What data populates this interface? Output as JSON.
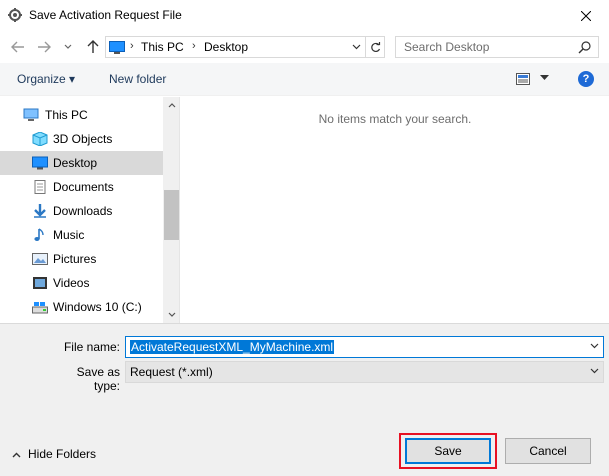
{
  "window": {
    "title": "Save Activation Request File"
  },
  "address": {
    "segments": [
      "This PC",
      "Desktop"
    ]
  },
  "search": {
    "placeholder": "Search Desktop"
  },
  "toolbar": {
    "organize_label": "Organize ▾",
    "new_folder_label": "New folder",
    "help_label": "?"
  },
  "navpane": {
    "items": [
      {
        "label": "This PC",
        "icon": "computer-icon",
        "indent": 0
      },
      {
        "label": "3D Objects",
        "icon": "3d-objects-icon",
        "indent": 1
      },
      {
        "label": "Desktop",
        "icon": "desktop-icon",
        "indent": 1,
        "selected": true
      },
      {
        "label": "Documents",
        "icon": "documents-icon",
        "indent": 1
      },
      {
        "label": "Downloads",
        "icon": "downloads-icon",
        "indent": 1
      },
      {
        "label": "Music",
        "icon": "music-icon",
        "indent": 1
      },
      {
        "label": "Pictures",
        "icon": "pictures-icon",
        "indent": 1
      },
      {
        "label": "Videos",
        "icon": "videos-icon",
        "indent": 1
      },
      {
        "label": "Windows 10 (C:)",
        "icon": "drive-icon",
        "indent": 1
      }
    ]
  },
  "content": {
    "empty_text": "No items match your search."
  },
  "form": {
    "filename_label": "File name:",
    "filename_value": "ActivateRequestXML_MyMachine.xml",
    "savetype_label": "Save as type:",
    "savetype_value": "Request (*.xml)"
  },
  "footer": {
    "hide_folders_label": "Hide Folders",
    "save_label": "Save",
    "cancel_label": "Cancel"
  },
  "colors": {
    "accent": "#0078d7",
    "highlight": "#e81123",
    "selected_bg": "#d9d9d9"
  }
}
